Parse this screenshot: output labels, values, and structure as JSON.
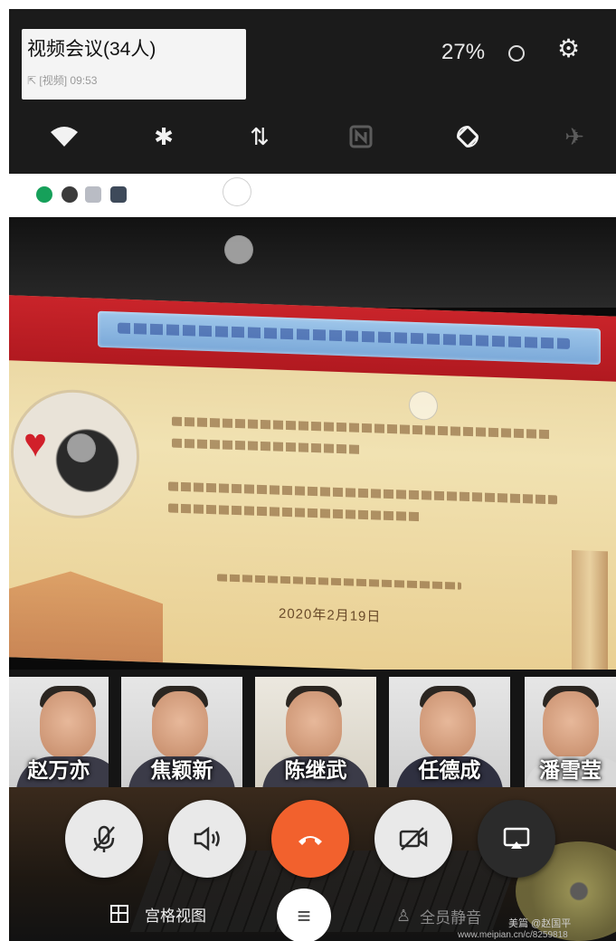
{
  "notification": {
    "title": "视频会议(34人)",
    "subtitle": "⇱ [视频] 09:53"
  },
  "status": {
    "battery": "27%"
  },
  "quick_settings": [
    {
      "icon": "wifi-icon",
      "glyph": "▼",
      "active": true
    },
    {
      "icon": "bluetooth-icon",
      "glyph": "✱",
      "active": true
    },
    {
      "icon": "mobile-data-icon",
      "glyph": "⇅",
      "active": true
    },
    {
      "icon": "nfc-icon",
      "glyph": "N",
      "active": false
    },
    {
      "icon": "auto-rotate-icon",
      "glyph": "⟳",
      "active": true
    },
    {
      "icon": "airplane-mode-icon",
      "glyph": "✈",
      "active": false
    }
  ],
  "slide": {
    "date": "2020年2月19日"
  },
  "participants": [
    {
      "name": "赵万亦"
    },
    {
      "name": "焦颖新"
    },
    {
      "name": "陈继武"
    },
    {
      "name": "任德成"
    },
    {
      "name": "潘雪莹"
    }
  ],
  "controls": {
    "grid_view_label": "宫格视图",
    "mute_all_label": "全员静音"
  },
  "watermark": {
    "brand": "美篇 @赵国平",
    "url": "www.meipian.cn/c/8259818"
  },
  "colors": {
    "hangup": "#f2612d",
    "slide_banner": "#c9242a"
  }
}
